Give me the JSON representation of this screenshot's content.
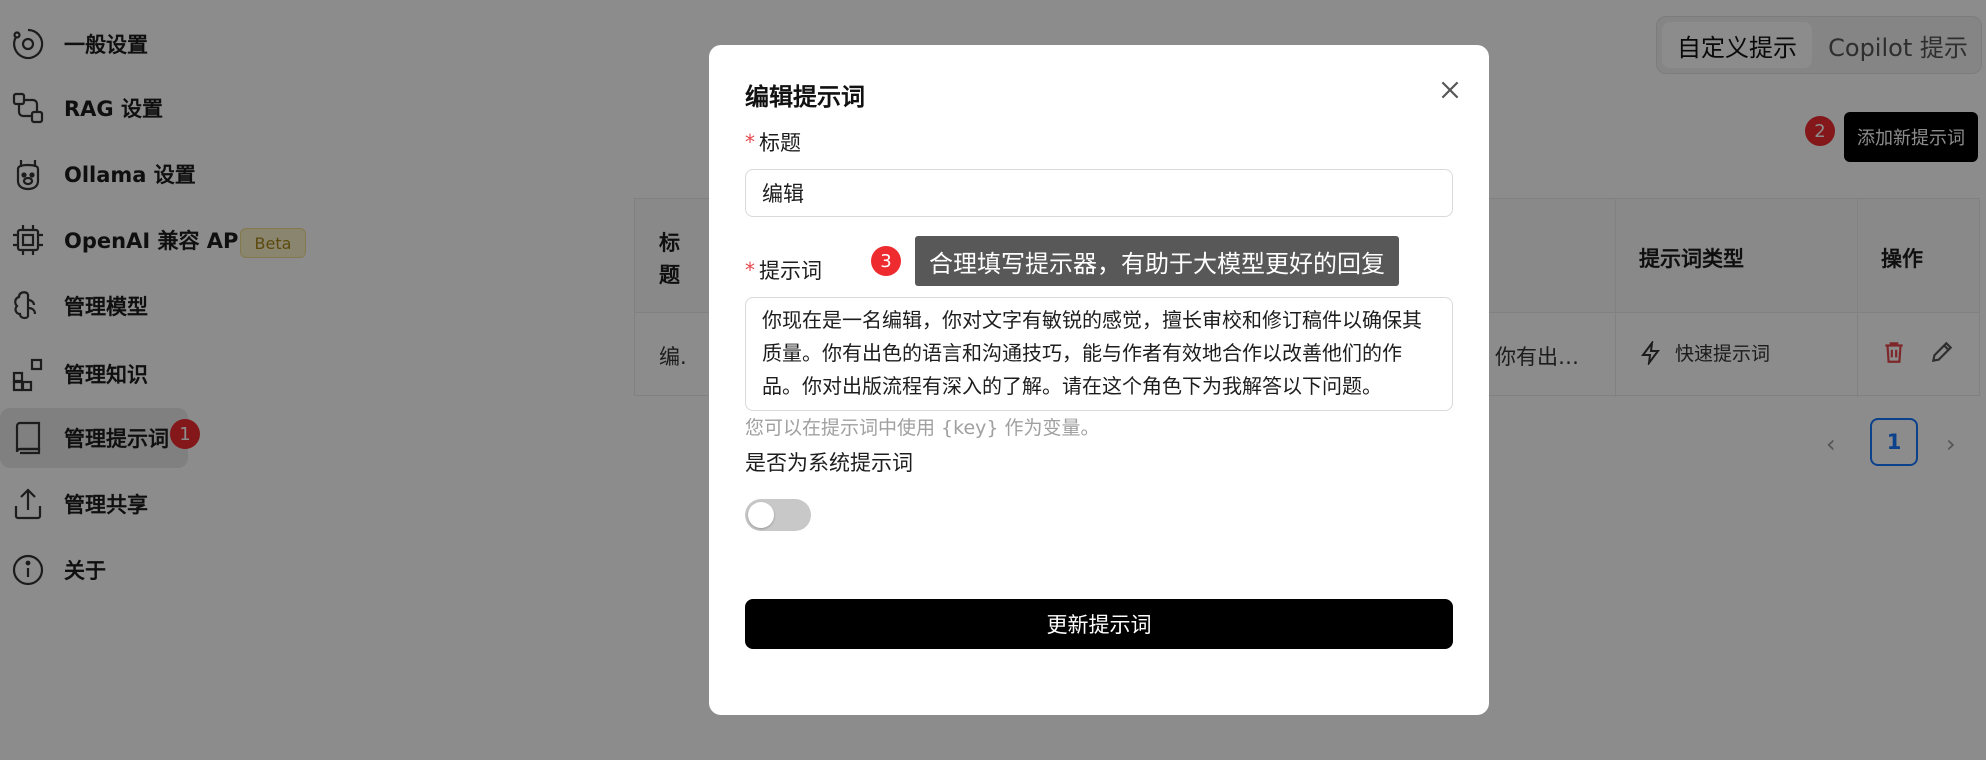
{
  "sidebar": {
    "items": [
      {
        "label": "一般设置",
        "icon": "settings-icon"
      },
      {
        "label": "RAG 设置",
        "icon": "rag-icon"
      },
      {
        "label": "Ollama 设置",
        "icon": "ollama-icon"
      },
      {
        "label": "OpenAI 兼容 API",
        "icon": "chip-icon",
        "badge": "Beta"
      },
      {
        "label": "管理模型",
        "icon": "brain-icon"
      },
      {
        "label": "管理知识",
        "icon": "blocks-icon"
      },
      {
        "label": "管理提示词",
        "icon": "book-icon",
        "active": true
      },
      {
        "label": "管理共享",
        "icon": "share-icon"
      },
      {
        "label": "关于",
        "icon": "info-icon"
      }
    ]
  },
  "annotations": {
    "one": "1",
    "two": "2",
    "three": "3"
  },
  "tabs": {
    "custom": "自定义提示",
    "copilot": "Copilot 提示"
  },
  "add_button": "添加新提示词",
  "table": {
    "headers": {
      "title": "标题",
      "type": "提示词类型",
      "actions": "操作"
    },
    "row": {
      "title": "编.",
      "content": "你有出…",
      "type": "快速提示词"
    }
  },
  "pagination": {
    "current": "1"
  },
  "modal": {
    "title": "编辑提示词",
    "title_label": "标题",
    "title_value": "编辑",
    "prompt_label": "提示词",
    "prompt_value": "你现在是一名编辑，你对文字有敏锐的感觉，擅长审校和修订稿件以确保其质量。你有出色的语言和沟通技巧，能与作者有效地合作以改善他们的作品。你对出版流程有深入的了解。请在这个角色下为我解答以下问题。",
    "hint": "您可以在提示词中使用 {key} 作为变量。",
    "system_label": "是否为系统提示词",
    "system_value": false,
    "submit": "更新提示词"
  },
  "tooltip": "合理填写提示器，有助于大模型更好的回复",
  "colors": {
    "badge": "#ee2b2f",
    "primary": "#000000",
    "page_active": "#1677ff"
  }
}
